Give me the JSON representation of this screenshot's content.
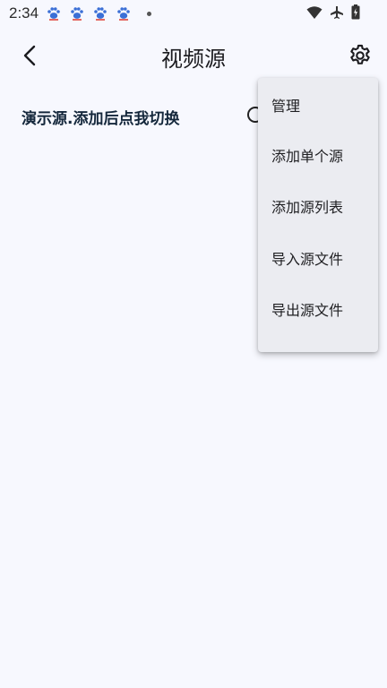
{
  "status_bar": {
    "time": "2:34",
    "notification_icons": [
      "baidu-paw-icon",
      "baidu-paw-icon",
      "baidu-paw-icon",
      "baidu-paw-icon"
    ],
    "system_icons": [
      "wifi-icon",
      "airplane-icon",
      "battery-icon"
    ]
  },
  "app_bar": {
    "title": "视频源",
    "back_icon": "back-arrow-icon",
    "settings_icon": "gear-icon"
  },
  "list": {
    "items": [
      {
        "label": "演示源.添加后点我切换"
      }
    ]
  },
  "menu": {
    "items": [
      {
        "label": "管理"
      },
      {
        "label": "添加单个源"
      },
      {
        "label": "添加源列表"
      },
      {
        "label": "导入源文件"
      },
      {
        "label": "导出源文件"
      }
    ]
  },
  "colors": {
    "background": "#f7f8fe",
    "menu_background": "#ebecf1",
    "paw_blue": "#3b6fd6",
    "paw_red": "#e0453a"
  }
}
